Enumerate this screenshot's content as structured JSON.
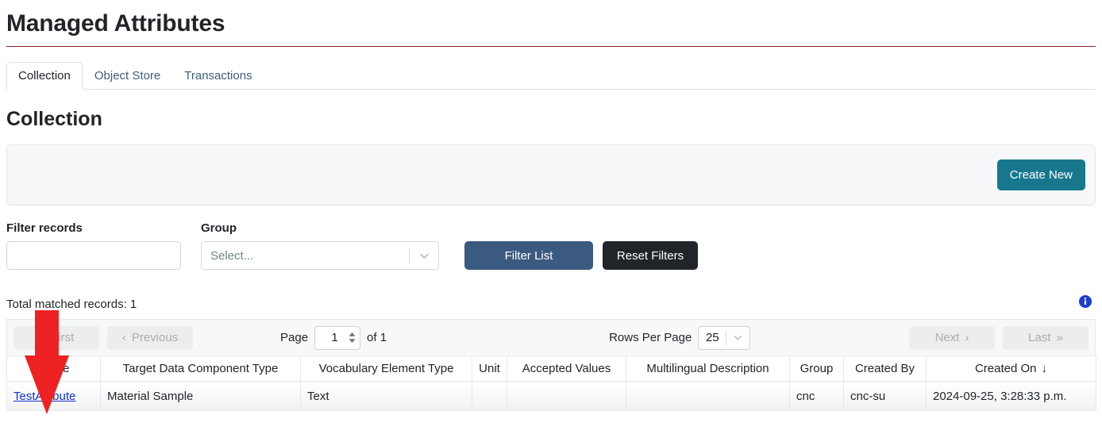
{
  "header": {
    "title": "Managed Attributes",
    "rule_color": "#8a1c2b"
  },
  "tabs": [
    {
      "label": "Collection",
      "active": true,
      "name": "tab-collection"
    },
    {
      "label": "Object Store",
      "active": false,
      "name": "tab-object-store"
    },
    {
      "label": "Transactions",
      "active": false,
      "name": "tab-transactions"
    }
  ],
  "section": {
    "title": "Collection"
  },
  "create_panel": {
    "button_label": "Create New",
    "button_color": "#17788d"
  },
  "filters": {
    "filter_records_label": "Filter records",
    "filter_records_value": "",
    "filter_records_placeholder": "",
    "group_label": "Group",
    "group_placeholder": "Select...",
    "filter_list_label": "Filter List",
    "filter_list_color": "#3b5a7f",
    "reset_filters_label": "Reset Filters",
    "reset_filters_color": "#212529"
  },
  "results": {
    "total_records_text": "Total matched records: 1",
    "info_icon": "info-circle-icon"
  },
  "pagination": {
    "first_label": "First",
    "previous_label": "Previous",
    "page_label": "Page",
    "page_value": "1",
    "of_label": "of 1",
    "rows_per_page_label": "Rows Per Page",
    "rows_per_page_value": "25",
    "next_label": "Next",
    "last_label": "Last"
  },
  "table": {
    "columns": [
      "Name",
      "Target Data Component Type",
      "Vocabulary Element Type",
      "Unit",
      "Accepted Values",
      "Multilingual Description",
      "Group",
      "Created By",
      "Created On"
    ],
    "sorted_column": "Created On",
    "sort_direction_glyph": "↓",
    "rows": [
      {
        "name": "TestAttibute",
        "target_data_component_type": "Material Sample",
        "vocabulary_element_type": "Text",
        "unit": "",
        "accepted_values": "",
        "multilingual_description": "",
        "group": "cnc",
        "created_by": "cnc-su",
        "created_on": "2024-09-25, 3:28:33 p.m."
      }
    ]
  },
  "annotation": {
    "arrow": "red-down-arrow",
    "color": "#ee2222"
  }
}
